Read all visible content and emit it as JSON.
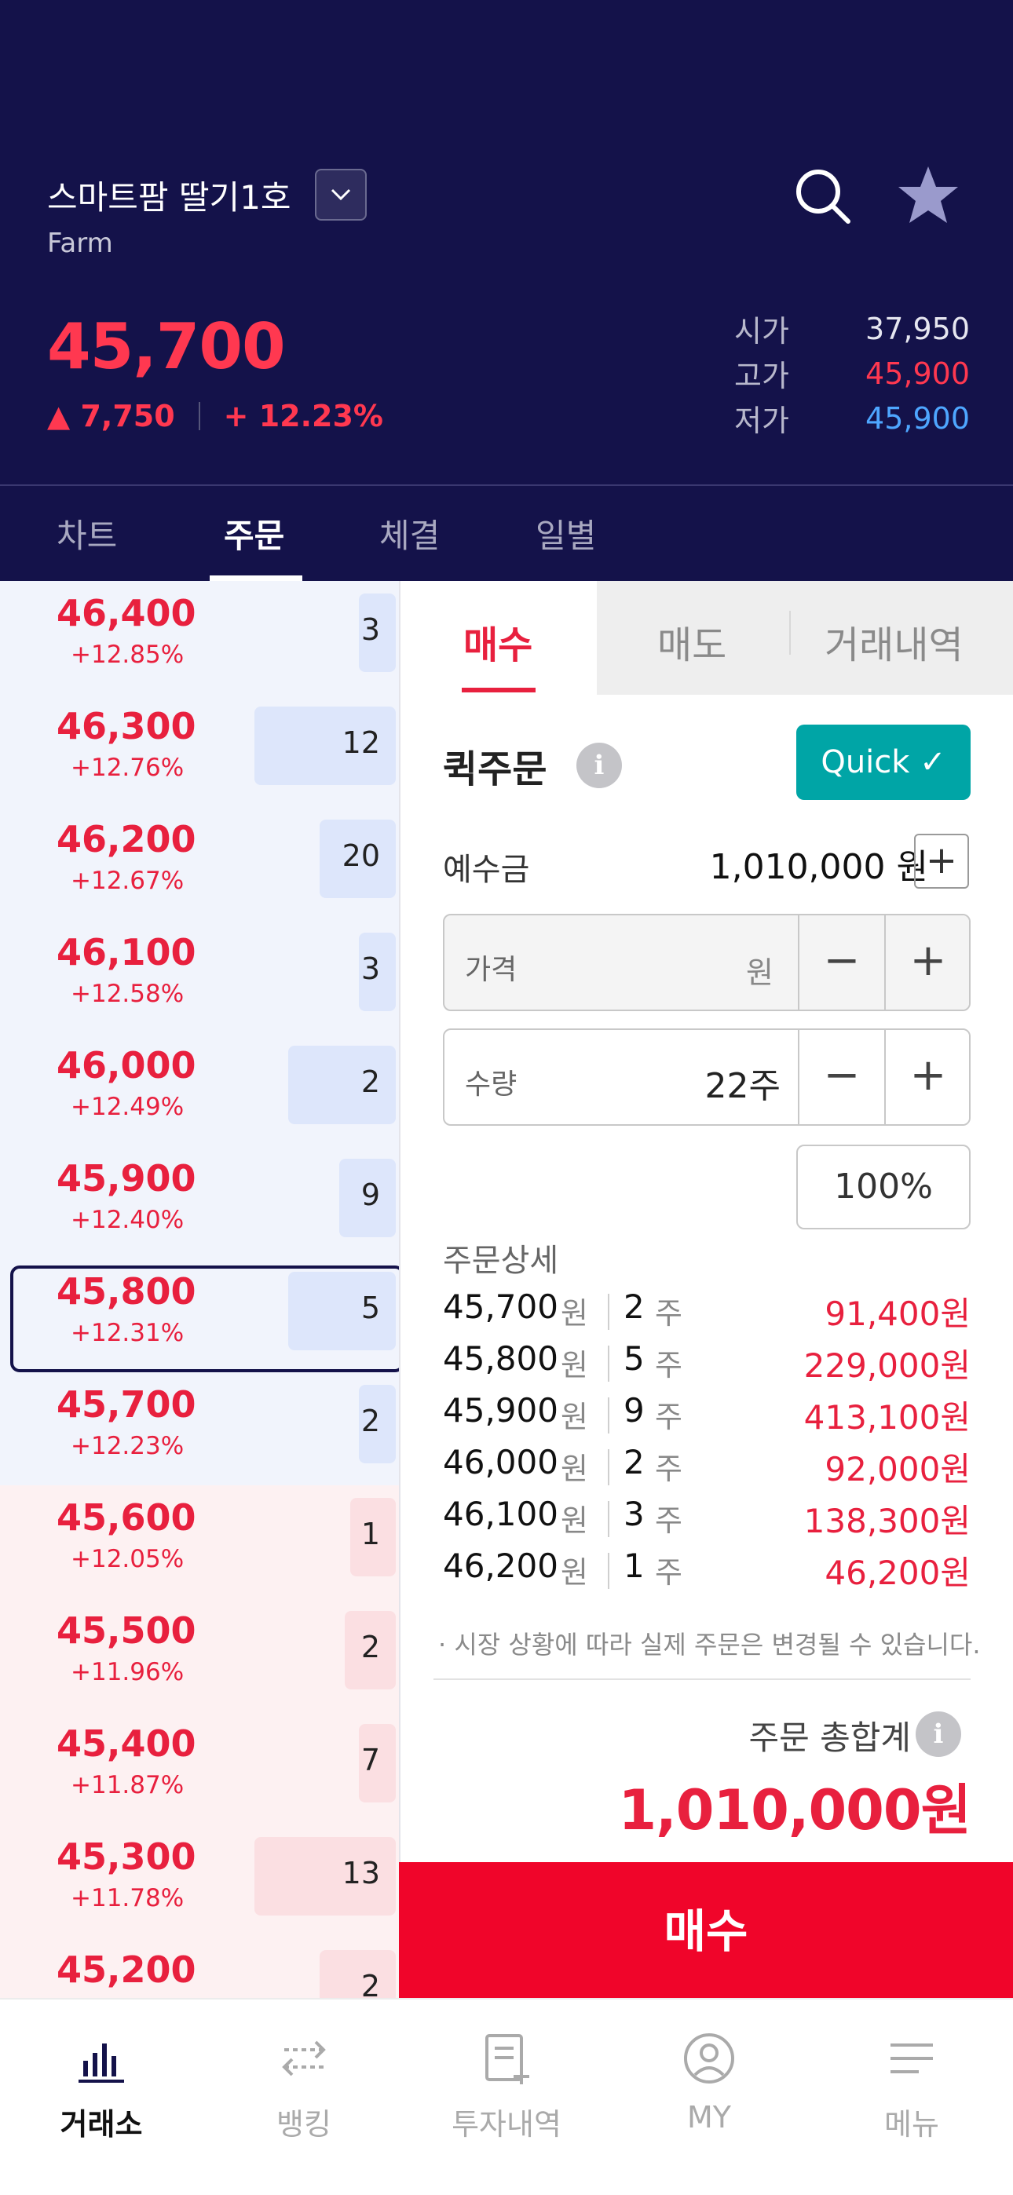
{
  "header": {
    "stock_name": "스마트팜 딸기1호",
    "stock_sub": "Farm",
    "current_price": "45,700",
    "change_amount": "▲ 7,750",
    "change_rate": "+ 12.23%",
    "open_label": "시가",
    "open_value": "37,950",
    "high_label": "고가",
    "high_value": "45,900",
    "low_label": "저가",
    "low_value": "45,900",
    "icons": [
      "chevron-down-icon",
      "search-icon",
      "star-icon"
    ]
  },
  "tabs": [
    {
      "label": "차트"
    },
    {
      "label": "주문"
    },
    {
      "label": "체결"
    },
    {
      "label": "일별"
    }
  ],
  "active_tab": "주문",
  "order_book": {
    "asks": [
      {
        "price": "46,400",
        "pct": "+12.85%",
        "qty": "3",
        "bar": 0.13
      },
      {
        "price": "46,300",
        "pct": "+12.76%",
        "qty": "12",
        "bar": 0.5
      },
      {
        "price": "46,200",
        "pct": "+12.67%",
        "qty": "20",
        "bar": 0.27
      },
      {
        "price": "46,100",
        "pct": "+12.58%",
        "qty": "3",
        "bar": 0.13
      },
      {
        "price": "46,000",
        "pct": "+12.49%",
        "qty": "2",
        "bar": 0.38
      },
      {
        "price": "45,900",
        "pct": "+12.40%",
        "qty": "9",
        "bar": 0.2
      },
      {
        "price": "45,800",
        "pct": "+12.31%",
        "qty": "5",
        "bar": 0.38
      },
      {
        "price": "45,700",
        "pct": "+12.23%",
        "qty": "2",
        "bar": 0.13
      }
    ],
    "bids": [
      {
        "price": "45,600",
        "pct": "+12.05%",
        "qty": "1",
        "bar": 0.16
      },
      {
        "price": "45,500",
        "pct": "+11.96%",
        "qty": "2",
        "bar": 0.18
      },
      {
        "price": "45,400",
        "pct": "+11.87%",
        "qty": "7",
        "bar": 0.13
      },
      {
        "price": "45,300",
        "pct": "+11.78%",
        "qty": "13",
        "bar": 0.5
      },
      {
        "price": "45,200",
        "pct": "",
        "qty": "2",
        "bar": 0.27
      }
    ],
    "selected_price": "45,800"
  },
  "order_panel": {
    "tab_buy": "매수",
    "tab_sell": "매도",
    "tab_history": "거래내역",
    "quick_title": "퀵주문",
    "quick_button": "Quick ✓",
    "info_glyph": "i",
    "deposit_label": "예수금",
    "deposit_value": "1,010,000 원",
    "deposit_plus": "+",
    "price_field_label": "가격",
    "price_field_unit": "원",
    "qty_field_label": "수량",
    "qty_field_value": "22주",
    "minus": "−",
    "plus": "+",
    "percent_button": "100%",
    "detail_title": "주문상세",
    "details": [
      {
        "price": "45,700",
        "won": "원",
        "qty": "2",
        "ju": "주",
        "amount": "91,400원"
      },
      {
        "price": "45,800",
        "won": "원",
        "qty": "5",
        "ju": "주",
        "amount": "229,000원"
      },
      {
        "price": "45,900",
        "won": "원",
        "qty": "9",
        "ju": "주",
        "amount": "413,100원"
      },
      {
        "price": "46,000",
        "won": "원",
        "qty": "2",
        "ju": "주",
        "amount": "92,000원"
      },
      {
        "price": "46,100",
        "won": "원",
        "qty": "3",
        "ju": "주",
        "amount": "138,300원"
      },
      {
        "price": "46,200",
        "won": "원",
        "qty": "1",
        "ju": "주",
        "amount": "46,200원"
      }
    ],
    "note": "· 시장 상황에 따라 실제 주문은 변경될 수 있습니다.",
    "total_label": "주문 총합계",
    "total_value": "1,010,000원",
    "submit_label": "매수"
  },
  "bottom_nav": [
    {
      "label": "거래소",
      "icon": "bar-chart-icon",
      "active": true
    },
    {
      "label": "뱅킹",
      "icon": "transfer-icon",
      "active": false
    },
    {
      "label": "투자내역",
      "icon": "document-plus-icon",
      "active": false
    },
    {
      "label": "MY",
      "icon": "user-circle-icon",
      "active": false
    },
    {
      "label": "메뉴",
      "icon": "menu-icon",
      "active": false
    }
  ],
  "colors": {
    "header_bg": "#14124a",
    "up_red": "#e8203e",
    "down_blue": "#4ea6ff",
    "quick_teal": "#00a5a6",
    "buy_red": "#f0052a"
  }
}
